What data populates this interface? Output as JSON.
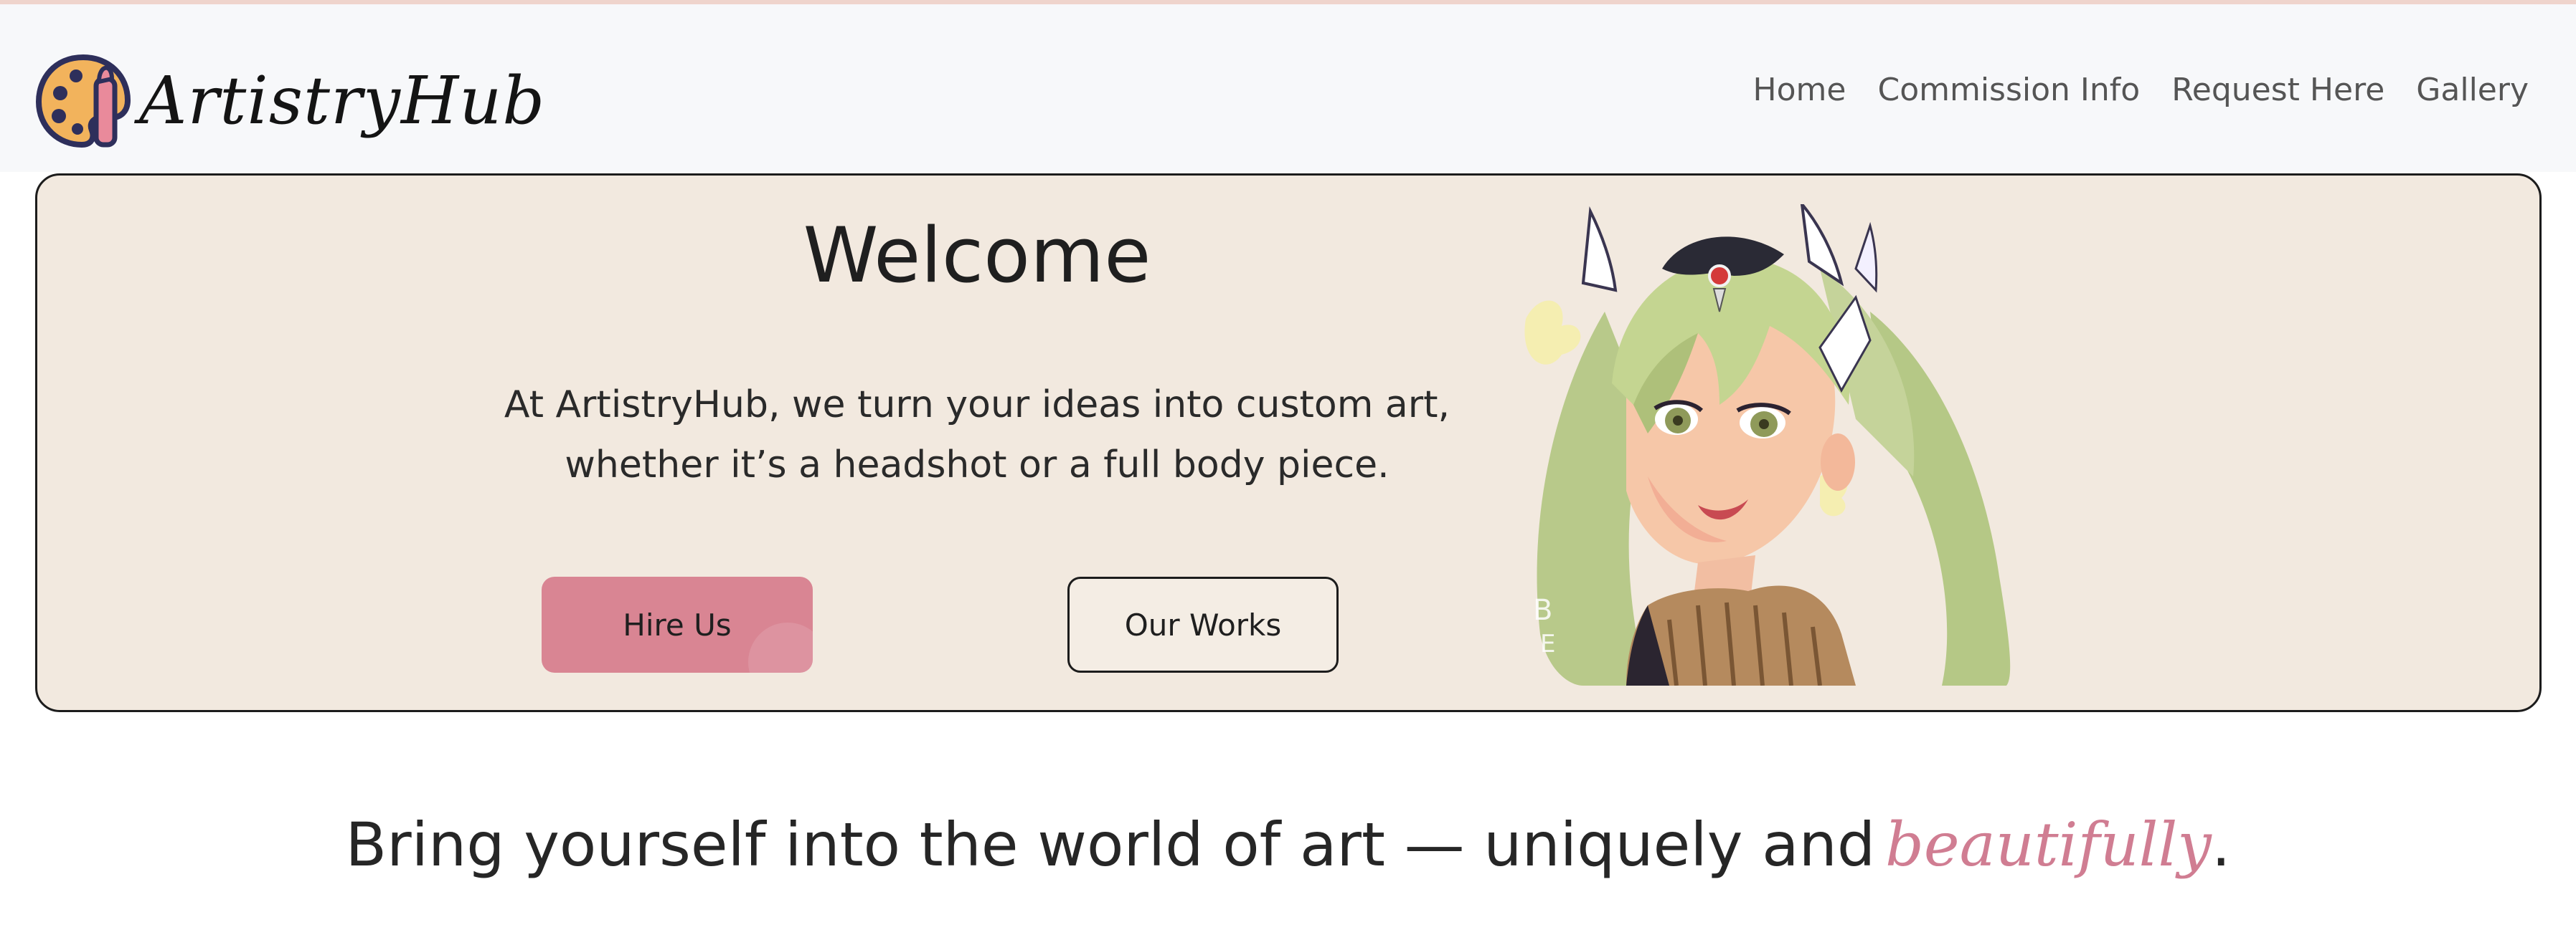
{
  "brand": {
    "name": "ArtistryHub",
    "logo_icon": "palette-brush-icon"
  },
  "nav": {
    "items": [
      {
        "label": "Home"
      },
      {
        "label": "Commission Info"
      },
      {
        "label": "Request Here"
      },
      {
        "label": "Gallery"
      }
    ]
  },
  "hero": {
    "title": "Welcome",
    "description_line1": "At ArtistryHub, we turn your ideas into custom art,",
    "description_line2": "whether it’s a headshot or a full body piece.",
    "hire_label": "Hire Us",
    "works_label": "Our Works",
    "illustration": "anime-girl-illustration"
  },
  "tagline": {
    "main": "Bring yourself into the world of art — uniquely and",
    "accent": "beautifully",
    "end": "."
  },
  "colors": {
    "header_bg": "#f7f8fa",
    "hero_bg": "#f2e9df",
    "accent_pink": "#d98593",
    "tagline_accent": "#d07d92",
    "text_dark": "#222222"
  }
}
